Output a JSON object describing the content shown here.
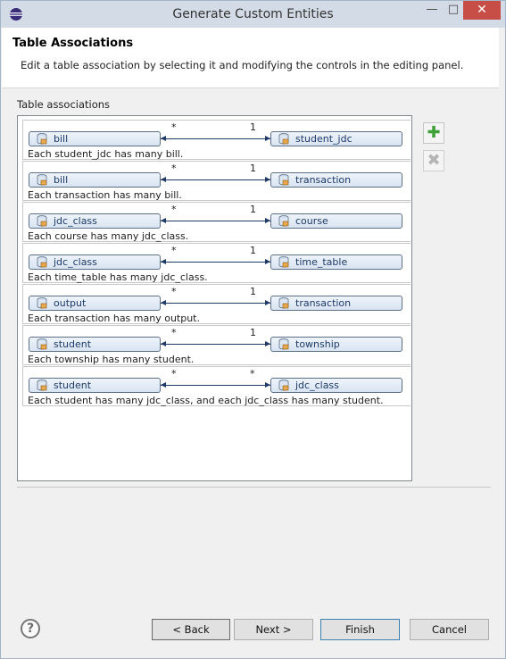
{
  "window": {
    "title": "Generate Custom Entities",
    "close_glyph": "✕",
    "min_glyph": "—",
    "max_glyph": "□"
  },
  "header": {
    "title": "Table Associations",
    "description": "Edit a table association by selecting it and modifying the controls in the editing panel."
  },
  "associations": {
    "label": "Table associations",
    "rows": [
      {
        "left": "bill",
        "right": "student_jdc",
        "left_card": "*",
        "right_card": "1",
        "description": "Each student_jdc has many bill."
      },
      {
        "left": "bill",
        "right": "transaction",
        "left_card": "*",
        "right_card": "1",
        "description": "Each transaction has many bill."
      },
      {
        "left": "jdc_class",
        "right": "course",
        "left_card": "*",
        "right_card": "1",
        "description": "Each course has many jdc_class."
      },
      {
        "left": "jdc_class",
        "right": "time_table",
        "left_card": "*",
        "right_card": "1",
        "description": "Each time_table has many jdc_class."
      },
      {
        "left": "output",
        "right": "transaction",
        "left_card": "*",
        "right_card": "1",
        "description": "Each transaction has many output."
      },
      {
        "left": "student",
        "right": "township",
        "left_card": "*",
        "right_card": "1",
        "description": "Each township has many student."
      },
      {
        "left": "student",
        "right": "jdc_class",
        "left_card": "*",
        "right_card": "*",
        "description": "Each student has many jdc_class, and each jdc_class has many student."
      }
    ]
  },
  "side_buttons": {
    "add_glyph": "✚",
    "remove_glyph": "✖"
  },
  "footer": {
    "help_glyph": "?",
    "back_label": "< Back",
    "next_label": "Next >",
    "finish_label": "Finish",
    "cancel_label": "Cancel"
  },
  "colors": {
    "accent": "#1f3a67",
    "add": "#3f9f38",
    "close": "#c74d47"
  }
}
